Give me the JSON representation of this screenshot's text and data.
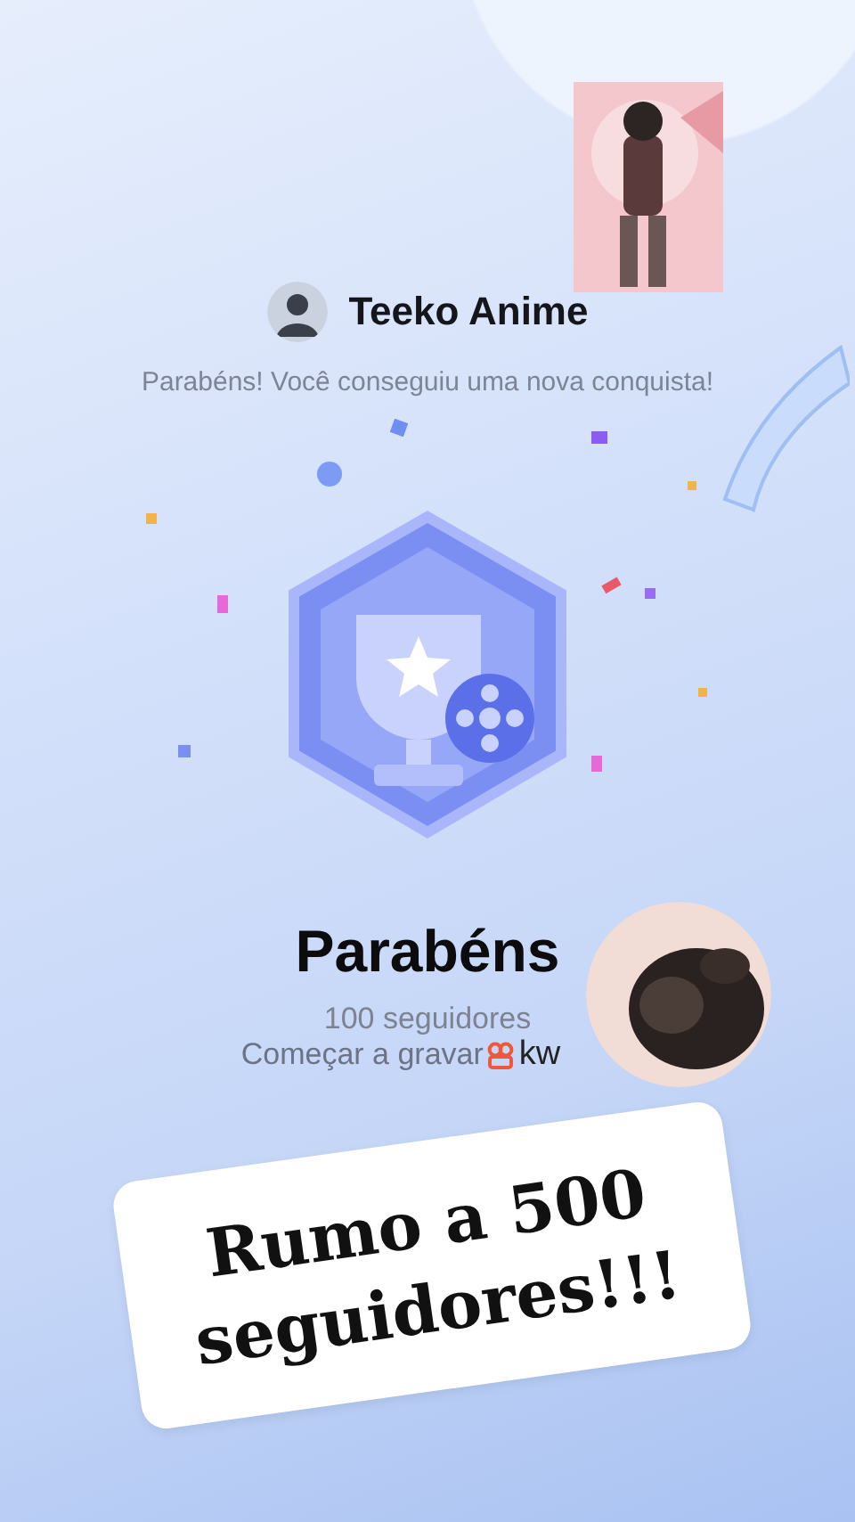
{
  "header": {
    "name": "Teeko Anime",
    "subtitle": "Parabéns! Você conseguiu uma nova conquista!"
  },
  "achievement": {
    "title": "Parabéns",
    "milestone": "100 seguidores",
    "action": "Começar a gravar",
    "brand": "kw"
  },
  "caption": {
    "lines": [
      "Rumo a 500",
      "seguidores!!!"
    ]
  }
}
